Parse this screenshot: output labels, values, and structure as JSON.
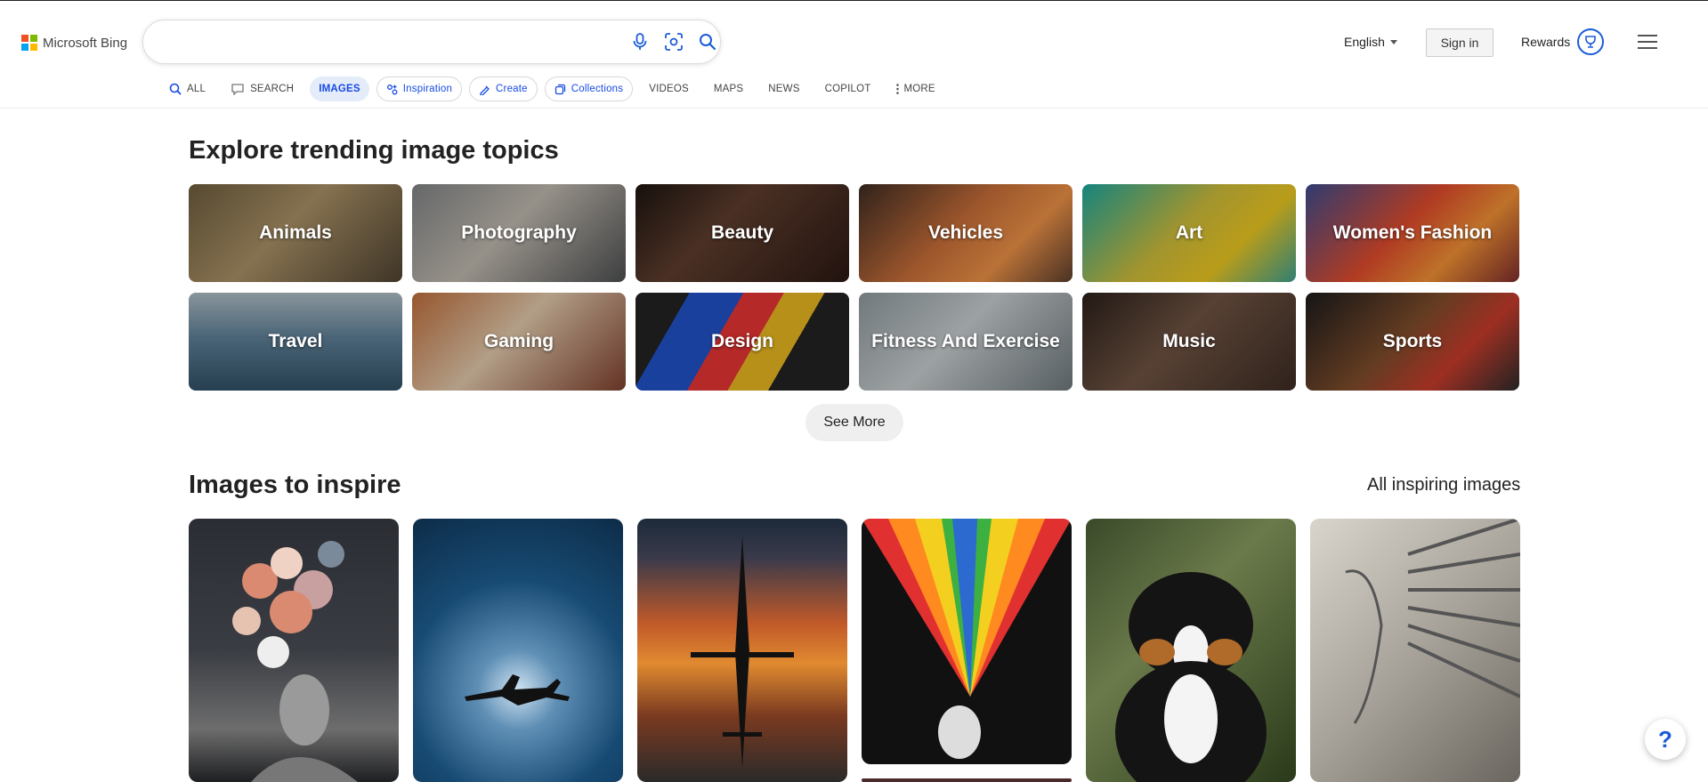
{
  "app": {
    "brand": "Microsoft Bing",
    "colors": {
      "accent": "#174ae4",
      "logo": [
        "#f25022",
        "#7fba00",
        "#00a4ef",
        "#ffb900"
      ]
    }
  },
  "search": {
    "value": "",
    "placeholder": "",
    "icons": [
      "microphone-icon",
      "visual-search-icon",
      "search-icon"
    ]
  },
  "header": {
    "language": "English",
    "sign_in": "Sign in",
    "rewards": "Rewards",
    "menu_icon": "hamburger-menu-icon"
  },
  "nav": {
    "items": [
      {
        "label": "ALL",
        "icon": "search-icon"
      },
      {
        "label": "SEARCH",
        "icon": "chat-icon"
      },
      {
        "label": "IMAGES",
        "active": true
      },
      {
        "label": "Inspiration",
        "icon": "inspiration-icon"
      },
      {
        "label": "Create",
        "icon": "create-icon"
      },
      {
        "label": "Collections",
        "icon": "collections-icon"
      },
      {
        "label": "VIDEOS"
      },
      {
        "label": "MAPS"
      },
      {
        "label": "NEWS"
      },
      {
        "label": "COPILOT"
      },
      {
        "label": "MORE",
        "icon": "more-vertical-icon"
      }
    ]
  },
  "trending": {
    "title": "Explore trending image topics",
    "see_more": "See More",
    "topics": [
      "Animals",
      "Photography",
      "Beauty",
      "Vehicles",
      "Art",
      "Women's Fashion",
      "Travel",
      "Gaming",
      "Design",
      "Fitness And Exercise",
      "Music",
      "Sports"
    ]
  },
  "inspire": {
    "title": "Images to inspire",
    "all_link": "All inspiring images"
  },
  "help": {
    "label": "?"
  }
}
